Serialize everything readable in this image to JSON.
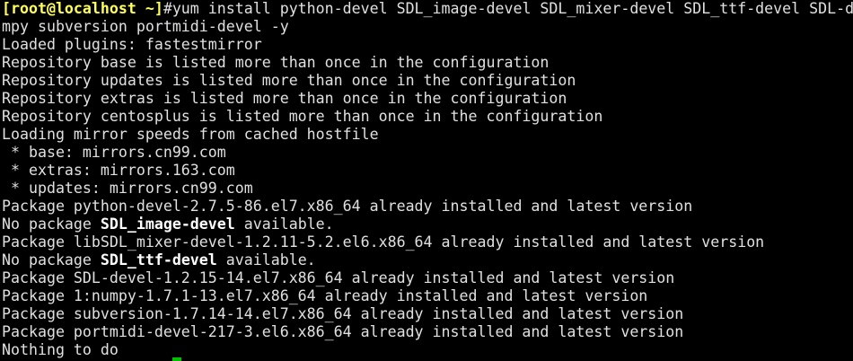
{
  "terminal": {
    "prompt": "[root@localhost ~]",
    "command_line_1": "#yum install python-devel SDL_image-devel SDL_mixer-devel SDL_ttf-devel SDL-de",
    "command_line_2": "mpy subversion portmidi-devel -y",
    "output": [
      "Loaded plugins: fastestmirror",
      "Repository base is listed more than once in the configuration",
      "Repository updates is listed more than once in the configuration",
      "Repository extras is listed more than once in the configuration",
      "Repository centosplus is listed more than once in the configuration",
      "Loading mirror speeds from cached hostfile",
      " * base: mirrors.cn99.com",
      " * extras: mirrors.163.com",
      " * updates: mirrors.cn99.com",
      "Package python-devel-2.7.5-86.el7.x86_64 already installed and latest version"
    ],
    "no_pkg_1": {
      "prefix": "No package ",
      "name": "SDL_image-devel",
      "suffix": " available."
    },
    "mixer_line": "Package libSDL_mixer-devel-1.2.11-5.2.el6.x86_64 already installed and latest version",
    "no_pkg_2": {
      "prefix": "No package ",
      "name": "SDL_ttf-devel",
      "suffix": " available."
    },
    "tail": [
      "Package SDL-devel-1.2.15-14.el7.x86_64 already installed and latest version",
      "Package 1:numpy-1.7.1-13.el7.x86_64 already installed and latest version",
      "Package subversion-1.7.14-14.el7.x86_64 already installed and latest version",
      "Package portmidi-devel-217-3.el6.x86_64 already installed and latest version",
      "Nothing to do"
    ]
  },
  "colors": {
    "background": "#000000",
    "text": "#e0e0e0",
    "prompt": "#ffff55",
    "cursor": "#00c000"
  }
}
